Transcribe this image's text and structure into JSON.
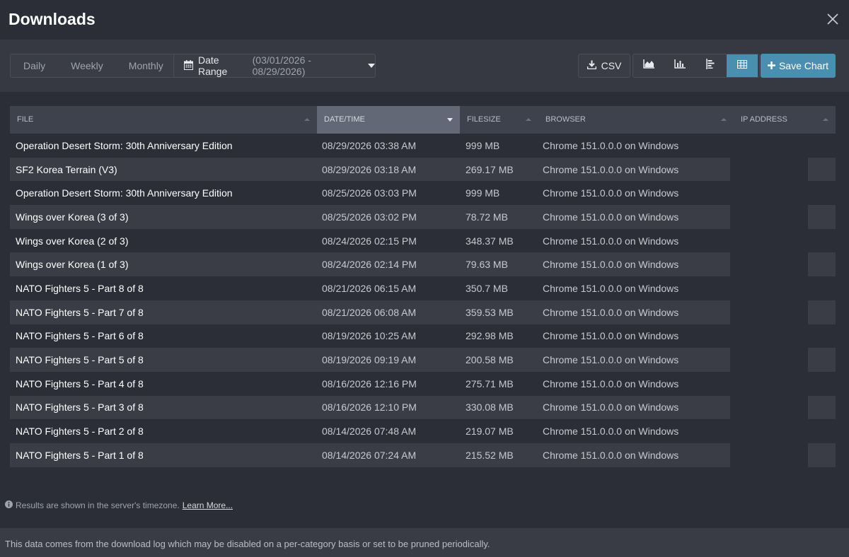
{
  "header": {
    "title": "Downloads"
  },
  "toolbar": {
    "periods": [
      "Daily",
      "Weekly",
      "Monthly"
    ],
    "date_range_label": "Date Range",
    "date_range_value": "(03/01/2026 - 08/29/2026)",
    "csv_label": "CSV",
    "save_label": "Save Chart",
    "view_icons": [
      "area-chart-icon",
      "bar-chart-icon",
      "horizontal-bar-chart-icon",
      "table-icon"
    ],
    "active_view": "table-icon"
  },
  "table": {
    "columns": [
      "FILE",
      "DATE/TIME",
      "FILESIZE",
      "BROWSER",
      "IP ADDRESS"
    ],
    "sorted_column": "DATE/TIME",
    "rows": [
      {
        "file": "Operation Desert Storm: 30th Anniversary Edition",
        "date": "08/29/2026 03:38 AM",
        "size": "999 MB",
        "browser": "Chrome 151.0.0.0 on Windows"
      },
      {
        "file": "SF2 Korea Terrain (V3)",
        "date": "08/29/2026 03:18 AM",
        "size": "269.17 MB",
        "browser": "Chrome 151.0.0.0 on Windows"
      },
      {
        "file": "Operation Desert Storm: 30th Anniversary Edition",
        "date": "08/25/2026 03:03 PM",
        "size": "999 MB",
        "browser": "Chrome 151.0.0.0 on Windows"
      },
      {
        "file": "Wings over Korea (3 of 3)",
        "date": "08/25/2026 03:02 PM",
        "size": "78.72 MB",
        "browser": "Chrome 151.0.0.0 on Windows"
      },
      {
        "file": "Wings over Korea (2 of 3)",
        "date": "08/24/2026 02:15 PM",
        "size": "348.37 MB",
        "browser": "Chrome 151.0.0.0 on Windows"
      },
      {
        "file": "Wings over Korea (1 of 3)",
        "date": "08/24/2026 02:14 PM",
        "size": "79.63 MB",
        "browser": "Chrome 151.0.0.0 on Windows"
      },
      {
        "file": "NATO Fighters 5 - Part 8 of 8",
        "date": "08/21/2026 06:15 AM",
        "size": "350.7 MB",
        "browser": "Chrome 151.0.0.0 on Windows"
      },
      {
        "file": "NATO Fighters 5 - Part 7 of 8",
        "date": "08/21/2026 06:08 AM",
        "size": "359.53 MB",
        "browser": "Chrome 151.0.0.0 on Windows"
      },
      {
        "file": "NATO Fighters 5 - Part 6 of 8",
        "date": "08/19/2026 10:25 AM",
        "size": "292.98 MB",
        "browser": "Chrome 151.0.0.0 on Windows"
      },
      {
        "file": "NATO Fighters 5 - Part 5 of 8",
        "date": "08/19/2026 09:19 AM",
        "size": "200.58 MB",
        "browser": "Chrome 151.0.0.0 on Windows"
      },
      {
        "file": "NATO Fighters 5 - Part 4 of 8",
        "date": "08/16/2026 12:16 PM",
        "size": "275.71 MB",
        "browser": "Chrome 151.0.0.0 on Windows"
      },
      {
        "file": "NATO Fighters 5 - Part 3 of 8",
        "date": "08/16/2026 12:10 PM",
        "size": "330.08 MB",
        "browser": "Chrome 151.0.0.0 on Windows"
      },
      {
        "file": "NATO Fighters 5 - Part 2 of 8",
        "date": "08/14/2026 07:48 AM",
        "size": "219.07 MB",
        "browser": "Chrome 151.0.0.0 on Windows"
      },
      {
        "file": "NATO Fighters 5 - Part 1 of 8",
        "date": "08/14/2026 07:24 AM",
        "size": "215.52 MB",
        "browser": "Chrome 151.0.0.0 on Windows"
      }
    ]
  },
  "note": {
    "text": "Results are shown in the server's timezone.",
    "link": "Learn More..."
  },
  "footer": {
    "text": "This data comes from the download log which may be disabled on a per-category basis or set to be pruned periodically."
  },
  "colors": {
    "accent": "#4a8fb0",
    "background": "#2b2e36",
    "toolbar": "#363942"
  }
}
